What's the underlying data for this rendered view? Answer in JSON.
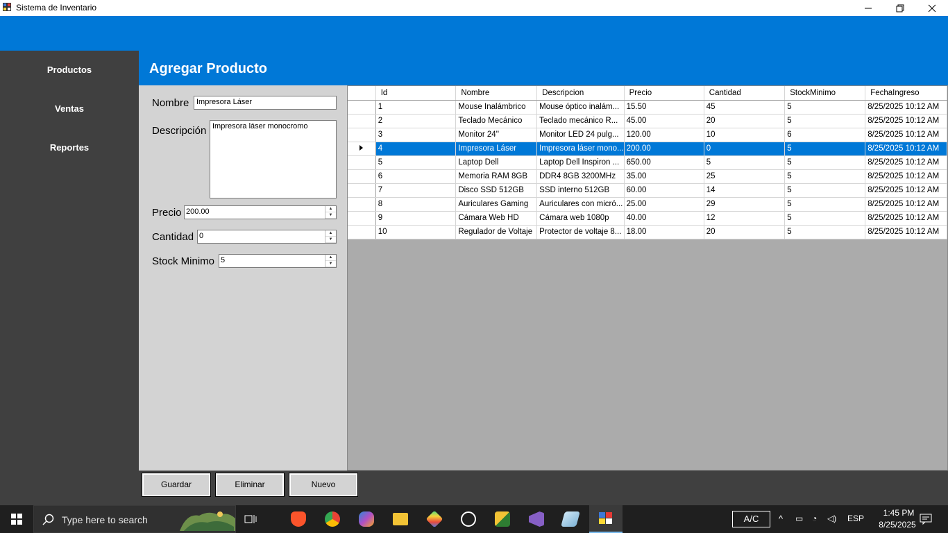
{
  "window": {
    "title": "Sistema de Inventario"
  },
  "header": {
    "title": "Agregar Producto"
  },
  "sidebar": {
    "items": [
      {
        "label": "Productos"
      },
      {
        "label": "Ventas"
      },
      {
        "label": "Reportes"
      }
    ]
  },
  "form": {
    "nombre_label": "Nombre",
    "nombre_value": "Impresora Láser",
    "descripcion_label": "Descripción",
    "descripcion_value": "Impresora láser monocromo",
    "precio_label": "Precio",
    "precio_value": "200.00",
    "cantidad_label": "Cantidad",
    "cantidad_value": "0",
    "stock_label": "Stock Minimo",
    "stock_value": "5"
  },
  "grid": {
    "columns": [
      "Id",
      "Nombre",
      "Descripcion",
      "Precio",
      "Cantidad",
      "StockMinimo",
      "FechaIngreso"
    ],
    "selected_row": 3,
    "rows": [
      [
        "1",
        "Mouse Inalámbrico",
        "Mouse óptico inalám...",
        "15.50",
        "45",
        "5",
        "8/25/2025 10:12 AM"
      ],
      [
        "2",
        "Teclado Mecánico",
        "Teclado mecánico R...",
        "45.00",
        "20",
        "5",
        "8/25/2025 10:12 AM"
      ],
      [
        "3",
        "Monitor 24''",
        "Monitor LED 24 pulg...",
        "120.00",
        "10",
        "6",
        "8/25/2025 10:12 AM"
      ],
      [
        "4",
        "Impresora Láser",
        "Impresora láser mono...",
        "200.00",
        "0",
        "5",
        "8/25/2025 10:12 AM"
      ],
      [
        "5",
        "Laptop Dell",
        "Laptop Dell Inspiron ...",
        "650.00",
        "5",
        "5",
        "8/25/2025 10:12 AM"
      ],
      [
        "6",
        "Memoria RAM 8GB",
        "DDR4 8GB 3200MHz",
        "35.00",
        "25",
        "5",
        "8/25/2025 10:12 AM"
      ],
      [
        "7",
        "Disco SSD 512GB",
        "SSD interno 512GB",
        "60.00",
        "14",
        "5",
        "8/25/2025 10:12 AM"
      ],
      [
        "8",
        "Auriculares Gaming",
        "Auriculares con micró...",
        "25.00",
        "29",
        "5",
        "8/25/2025 10:12 AM"
      ],
      [
        "9",
        "Cámara Web HD",
        "Cámara web 1080p",
        "40.00",
        "12",
        "5",
        "8/25/2025 10:12 AM"
      ],
      [
        "10",
        "Regulador de Voltaje",
        "Protector de voltaje 8...",
        "18.00",
        "20",
        "5",
        "8/25/2025 10:12 AM"
      ]
    ]
  },
  "buttons": {
    "guardar": "Guardar",
    "eliminar": "Eliminar",
    "nuevo": "Nuevo"
  },
  "taskbar": {
    "search_placeholder": "Type here to search",
    "ac_label": "A/C",
    "language": "ESP",
    "time": "1:45 PM",
    "date": "8/25/2025",
    "apps": [
      "brave-icon",
      "chrome-icon",
      "m365-icon",
      "file-explorer-icon",
      "app-icon",
      "media-player-icon",
      "app-icon-2",
      "visual-studio-icon",
      "app-icon-3",
      "inventory-app-icon"
    ]
  },
  "colors": {
    "accent": "#0078d7",
    "sidebar": "#404040",
    "form_panel": "#d3d3d3",
    "grid_background": "#ababab"
  }
}
